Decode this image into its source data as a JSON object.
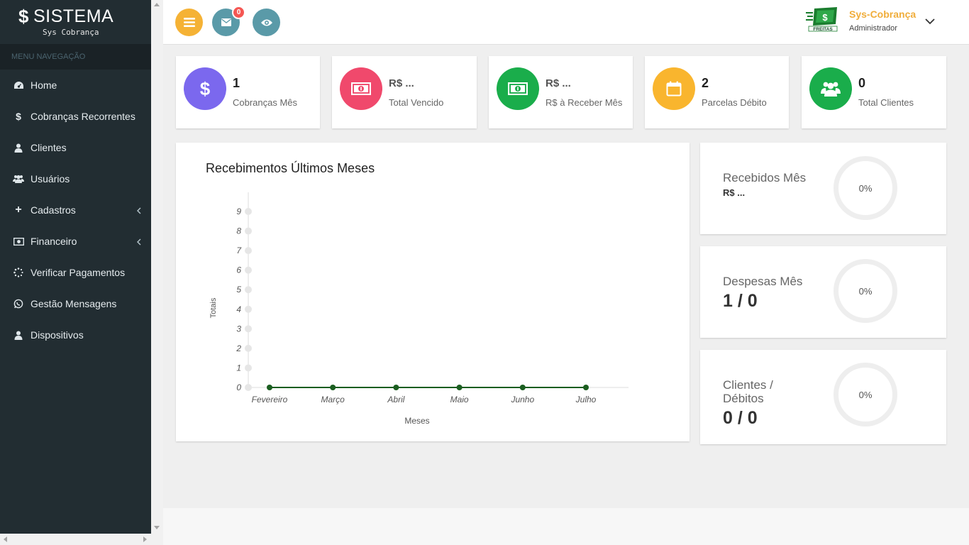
{
  "brand": {
    "title": "SISTEMA",
    "subtitle": "Sys Cobrança"
  },
  "sidebar": {
    "header": "MENU NAVEGAÇÃO",
    "items": [
      {
        "label": "Home",
        "icon": "dashboard-icon"
      },
      {
        "label": "Cobranças Recorrentes",
        "icon": "dollar-icon"
      },
      {
        "label": "Clientes",
        "icon": "user-icon"
      },
      {
        "label": "Usuários",
        "icon": "users-icon"
      },
      {
        "label": "Cadastros",
        "icon": "plus-icon"
      },
      {
        "label": "Financeiro",
        "icon": "money-icon"
      },
      {
        "label": "Verificar Pagamentos",
        "icon": "spinner-icon"
      },
      {
        "label": "Gestão Mensagens",
        "icon": "whatsapp-icon"
      },
      {
        "label": "Dispositivos",
        "icon": "user-icon"
      }
    ]
  },
  "header": {
    "notifications_count": "0",
    "user_name": "Sys-Cobrança",
    "user_role": "Administrador",
    "colors": {
      "menu": "#f5b235",
      "mail": "#5a9aa8",
      "view": "#5a9aa8"
    }
  },
  "stats": [
    {
      "value": "1",
      "label": "Cobranças Mês",
      "color": "#7b68ee",
      "icon": "dollar-icon"
    },
    {
      "value": "R$ ...",
      "label": "Total Vencido",
      "color": "#f0496c",
      "icon": "money-icon"
    },
    {
      "value": "R$ ...",
      "label": "R$ à Receber Mês",
      "color": "#1aad4b",
      "icon": "money-icon"
    },
    {
      "value": "2",
      "label": "Parcelas Débito",
      "color": "#f9b52e",
      "icon": "calendar-icon"
    },
    {
      "value": "0",
      "label": "Total Clientes",
      "color": "#1aad4b",
      "icon": "users-icon"
    }
  ],
  "chart_data": {
    "type": "line",
    "title": "Recebimentos Últimos Meses",
    "xlabel": "Meses",
    "ylabel": "Totais",
    "categories": [
      "Fevereiro",
      "Março",
      "Abril",
      "Maio",
      "Junho",
      "Julho"
    ],
    "series": [
      {
        "values": [
          0,
          0,
          0,
          0,
          0,
          0
        ],
        "color": "#1b5e20"
      }
    ],
    "yticks": [
      0,
      1,
      2,
      3,
      4,
      5,
      6,
      7,
      8,
      9
    ],
    "ylim": [
      0,
      9
    ],
    "grid": false
  },
  "info": [
    {
      "title": "Recebidos Mês",
      "value": "R$ ...",
      "percent": "0%"
    },
    {
      "title": "Despesas Mês",
      "value": "1 / 0",
      "percent": "0%"
    },
    {
      "title": "Clientes / Débitos",
      "value": "0 / 0",
      "percent": "0%"
    }
  ]
}
